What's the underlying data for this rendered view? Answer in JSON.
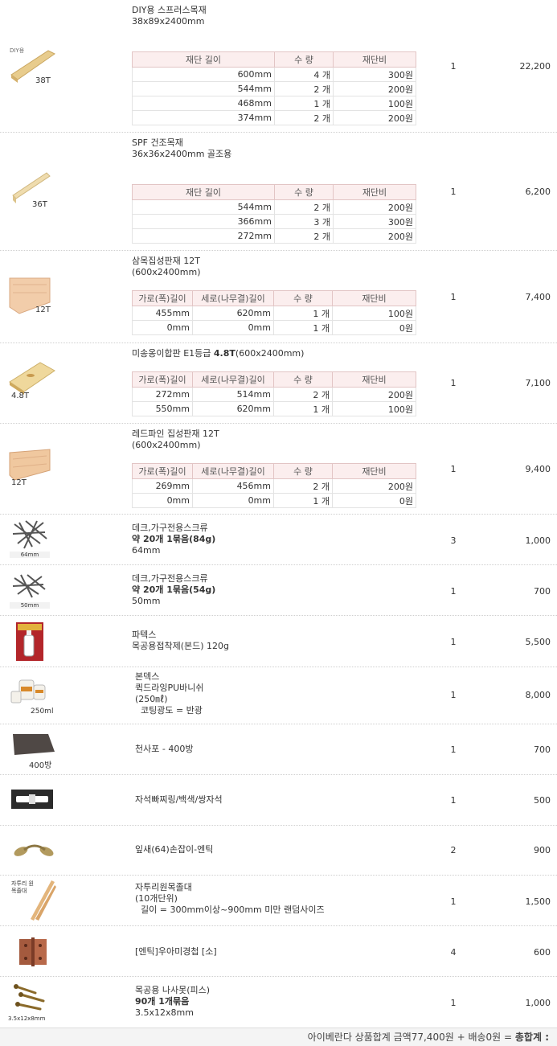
{
  "items": [
    {
      "name": "DIY용 스프러스목재",
      "sub": "38x89x2400mm",
      "thumb_label": "38T",
      "thumb_top": "DIY용",
      "qty": "1",
      "price": "22,200",
      "table": {
        "headers": [
          "재단 길이",
          "수 량",
          "재단비"
        ],
        "rows": [
          [
            "600mm",
            "4 개",
            "300원"
          ],
          [
            "544mm",
            "2 개",
            "200원"
          ],
          [
            "468mm",
            "1 개",
            "100원"
          ],
          [
            "374mm",
            "2 개",
            "200원"
          ]
        ]
      }
    },
    {
      "name": "SPF 건조목재",
      "sub": "36x36x2400mm 골조용",
      "thumb_label": "36T",
      "qty": "1",
      "price": "6,200",
      "table": {
        "headers": [
          "재단 길이",
          "수 량",
          "재단비"
        ],
        "rows": [
          [
            "544mm",
            "2 개",
            "200원"
          ],
          [
            "366mm",
            "3 개",
            "300원"
          ],
          [
            "272mm",
            "2 개",
            "200원"
          ]
        ]
      }
    },
    {
      "name": "삼목집성판재 12T",
      "sub": "(600x2400mm)",
      "thumb_label": "12T",
      "qty": "1",
      "price": "7,400",
      "table": {
        "headers": [
          "가로(폭)길이",
          "세로(나무결)길이",
          "수 량",
          "재단비"
        ],
        "rows": [
          [
            "455mm",
            "620mm",
            "1 개",
            "100원"
          ],
          [
            "0mm",
            "0mm",
            "1 개",
            "0원"
          ]
        ]
      }
    },
    {
      "name": "미송옹이합판 E1등급 ",
      "name_bold": "4.8T",
      "name_tail": "(600x2400mm)",
      "thumb_label": "4.8T",
      "qty": "1",
      "price": "7,100",
      "table": {
        "headers": [
          "가로(폭)길이",
          "세로(나무결)길이",
          "수 량",
          "재단비"
        ],
        "rows": [
          [
            "272mm",
            "514mm",
            "2 개",
            "200원"
          ],
          [
            "550mm",
            "620mm",
            "1 개",
            "100원"
          ]
        ]
      }
    },
    {
      "name": "레드파인 집성판재 12T",
      "sub": "(600x2400mm)",
      "thumb_label": "12T",
      "qty": "1",
      "price": "9,400",
      "table": {
        "headers": [
          "가로(폭)길이",
          "세로(나무결)길이",
          "수 량",
          "재단비"
        ],
        "rows": [
          [
            "269mm",
            "456mm",
            "2 개",
            "200원"
          ],
          [
            "0mm",
            "0mm",
            "1 개",
            "0원"
          ]
        ]
      }
    },
    {
      "name": "데크,가구전용스크류",
      "bold": "약 20개 1묶음(84g)",
      "sub": "64mm",
      "thumb_label": "64mm",
      "qty": "3",
      "price": "1,000"
    },
    {
      "name": "데크,가구전용스크류",
      "bold": "약 20개 1묶음(54g)",
      "sub": "50mm",
      "thumb_label": "50mm",
      "qty": "1",
      "price": "700"
    },
    {
      "name": "파텍스",
      "sub": "목공용접착제(본드) 120g",
      "qty": "1",
      "price": "5,500"
    },
    {
      "name": "본덱스",
      "sub": "퀵드라잉PU바니쉬",
      "sub2": "(250㎖)",
      "sub3": "  코팅광도 = 반광",
      "thumb_label": "250ml",
      "qty": "1",
      "price": "8,000"
    },
    {
      "name": "천사포 - 400방",
      "thumb_label": "400방",
      "qty": "1",
      "price": "700"
    },
    {
      "name": "자석빠찌링/백색/쌍자석",
      "qty": "1",
      "price": "500"
    },
    {
      "name": "잎새(64)손잡이-엔틱",
      "qty": "2",
      "price": "900"
    },
    {
      "name": "자투리원목졸대",
      "sub": "(10개단위)",
      "sub2": "  길이 = 300mm이상~900mm 미만 랜덤사이즈",
      "thumb_label": "자투리 원목졸대",
      "qty": "1",
      "price": "1,500"
    },
    {
      "name": "[엔틱]우아미경첩 [소]",
      "qty": "4",
      "price": "600"
    },
    {
      "name": "목공용 나사못(피스)",
      "bold": "90개 1개묶음",
      "sub": "3.5x12x8mm",
      "thumb_label": "3.5x12x8mm",
      "qty": "1",
      "price": "1,000"
    }
  ],
  "footer": {
    "text": "아이베란다 상품합계 금액77,400원 + 배송0원 = ",
    "total": "총합계 :"
  }
}
